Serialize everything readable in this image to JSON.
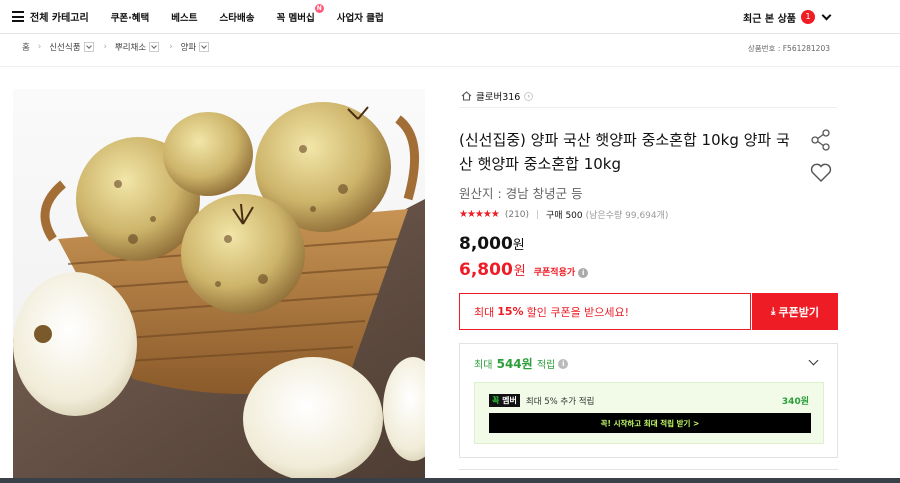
{
  "nav": {
    "menu_label": "전체 카테고리",
    "items": [
      {
        "label": "쿠폰·혜택"
      },
      {
        "label": "베스트"
      },
      {
        "label": "스타배송"
      },
      {
        "label": "꼭 멤버십",
        "badge": "N"
      },
      {
        "label": "사업자 클럽"
      }
    ],
    "recent_label": "최근 본 상품",
    "recent_count": "1"
  },
  "breadcrumb": {
    "home": "홈",
    "items": [
      "신선식품",
      "뿌리채소",
      "양파"
    ],
    "product_number": "상품번호 : F561281203"
  },
  "seller": {
    "name": "클로버316"
  },
  "product": {
    "title": "(신선집중) 양파 국산 햇양파 중소혼합 10kg 양파 국산 햇양파 중소혼합 10kg",
    "origin": "원산지 : 경남 창녕군 등",
    "rating_stars": 4.5,
    "rating_count": "(210)",
    "purchase_count": "구매 500",
    "remaining": "(남은수량 99,694개)",
    "price_original": "8,000",
    "price_sale": "6,800",
    "won": "원",
    "coupon_applicable": "쿠폰적용가"
  },
  "coupon": {
    "text_prefix": "최대",
    "text_percent": "15%",
    "text_suffix": "할인 쿠폰을 받으세요!",
    "button_label": "쿠폰받기"
  },
  "points": {
    "prefix": "최대",
    "amount": "544원",
    "suffix": "적립",
    "member_badge_1": "꼭",
    "member_badge_2": "멤버",
    "member_text": "최대 5% 추가 적립",
    "member_points": "340원",
    "member_button": "꼭! 시작하고 최대 적립 받기 >"
  },
  "colors": {
    "accent": "#ee1c25",
    "green": "#2c9e3a",
    "member_bg": "#f1fbe8"
  },
  "icons": [
    "menu-icon",
    "chevron-down-icon",
    "home-icon",
    "share-icon",
    "heart-icon",
    "info-icon",
    "download-icon"
  ]
}
